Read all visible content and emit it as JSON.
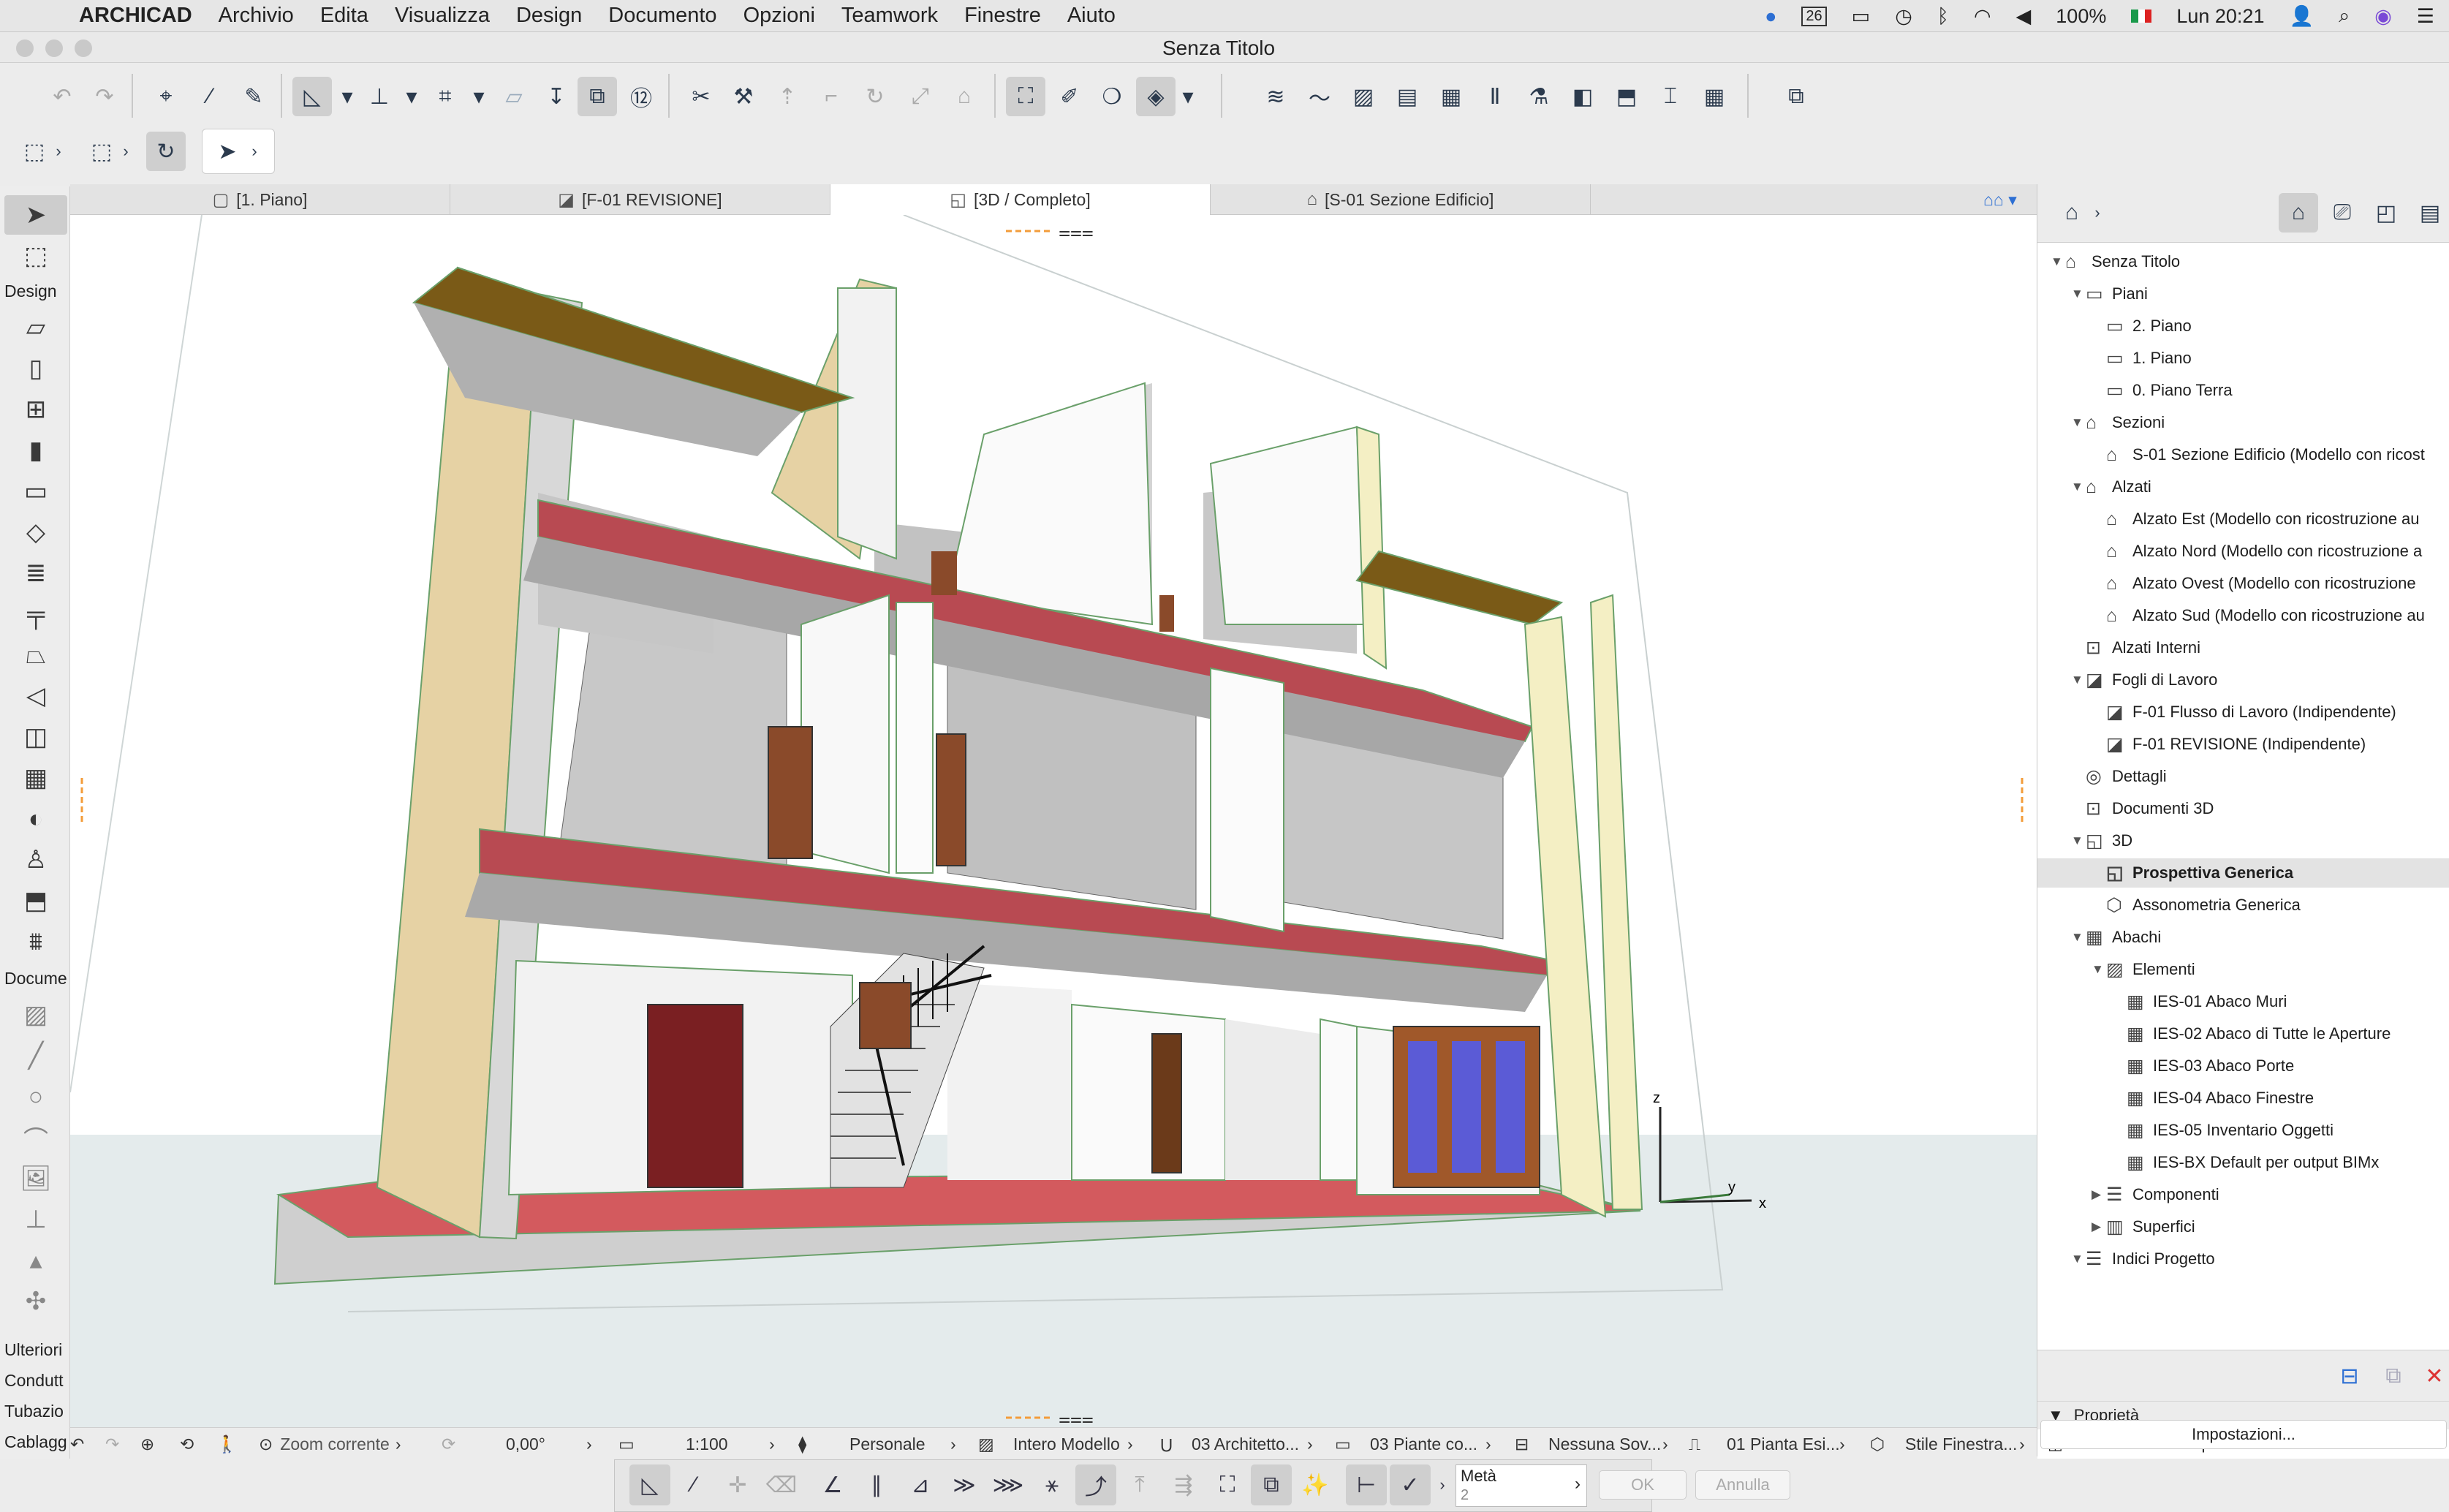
{
  "menubar": {
    "app": "ARCHICAD",
    "items": [
      "Archivio",
      "Edita",
      "Visualizza",
      "Design",
      "Documento",
      "Opzioni",
      "Teamwork",
      "Finestre",
      "Aiuto"
    ],
    "status": {
      "calendar_day": "26",
      "battery": "100%",
      "datetime": "Lun 20:21"
    }
  },
  "window": {
    "title": "Senza Titolo"
  },
  "tabs": [
    {
      "label": "[1. Piano]"
    },
    {
      "label": "[F-01 REVISIONE]"
    },
    {
      "label": "[3D / Completo]"
    },
    {
      "label": "[S-01 Sezione Edificio]"
    }
  ],
  "toolbox": {
    "design_label": "Design",
    "document_label": "Docume",
    "more_label": "Ulteriori",
    "conduit_label": "Condutt",
    "pipe_label": "Tubazio",
    "cable_label": "Cablagg"
  },
  "statusbar": {
    "zoom": "Zoom corrente",
    "angle": "0,00°",
    "scale": "1:100",
    "layer": "Personale",
    "model": "Intero Modello",
    "pen": "03 Architetto...",
    "override": "03 Piante co...",
    "renovation": "Nessuna Sov...",
    "structure": "01 Pianta Esi...",
    "window_style": "Stile Finestra..."
  },
  "infobox": {
    "label": "Metà",
    "value": "2",
    "ok": "OK",
    "cancel": "Annulla"
  },
  "navigator": {
    "tree": [
      {
        "label": "Senza Titolo",
        "level": 0,
        "expand": "open",
        "icon": "project-icon"
      },
      {
        "label": "Piani",
        "level": 1,
        "expand": "open",
        "icon": "stories-icon"
      },
      {
        "label": "2. Piano",
        "level": 2,
        "expand": "",
        "icon": "story-icon"
      },
      {
        "label": "1. Piano",
        "level": 2,
        "expand": "",
        "icon": "story-icon"
      },
      {
        "label": "0. Piano Terra",
        "level": 2,
        "expand": "",
        "icon": "story-icon"
      },
      {
        "label": "Sezioni",
        "level": 1,
        "expand": "open",
        "icon": "section-icon"
      },
      {
        "label": "S-01 Sezione Edificio (Modello con ricost",
        "level": 2,
        "expand": "",
        "icon": "section-icon"
      },
      {
        "label": "Alzati",
        "level": 1,
        "expand": "open",
        "icon": "elevation-icon"
      },
      {
        "label": "Alzato Est (Modello con ricostruzione au",
        "level": 2,
        "expand": "",
        "icon": "elevation-icon"
      },
      {
        "label": "Alzato Nord (Modello con ricostruzione a",
        "level": 2,
        "expand": "",
        "icon": "elevation-icon"
      },
      {
        "label": "Alzato Ovest (Modello con ricostruzione",
        "level": 2,
        "expand": "",
        "icon": "elevation-icon"
      },
      {
        "label": "Alzato Sud (Modello con ricostruzione au",
        "level": 2,
        "expand": "",
        "icon": "elevation-icon"
      },
      {
        "label": "Alzati Interni",
        "level": 1,
        "expand": "",
        "icon": "interior-elevation-icon"
      },
      {
        "label": "Fogli di Lavoro",
        "level": 1,
        "expand": "open",
        "icon": "worksheet-icon"
      },
      {
        "label": "F-01 Flusso di Lavoro (Indipendente)",
        "level": 2,
        "expand": "",
        "icon": "worksheet-icon"
      },
      {
        "label": "F-01 REVISIONE (Indipendente)",
        "level": 2,
        "expand": "",
        "icon": "worksheet-icon"
      },
      {
        "label": "Dettagli",
        "level": 1,
        "expand": "",
        "icon": "detail-icon"
      },
      {
        "label": "Documenti 3D",
        "level": 1,
        "expand": "",
        "icon": "3d-document-icon"
      },
      {
        "label": "3D",
        "level": 1,
        "expand": "open",
        "icon": "3d-icon"
      },
      {
        "label": "Prospettiva Generica",
        "level": 2,
        "expand": "",
        "icon": "perspective-icon",
        "selected": true
      },
      {
        "label": "Assonometria Generica",
        "level": 2,
        "expand": "",
        "icon": "axonometry-icon"
      },
      {
        "label": "Abachi",
        "level": 1,
        "expand": "open",
        "icon": "schedule-icon"
      },
      {
        "label": "Elementi",
        "level": 2,
        "expand": "open",
        "icon": "elements-icon"
      },
      {
        "label": "IES-01 Abaco Muri",
        "level": 3,
        "expand": "",
        "icon": "schedule-icon"
      },
      {
        "label": "IES-02 Abaco di Tutte le Aperture",
        "level": 3,
        "expand": "",
        "icon": "schedule-icon"
      },
      {
        "label": "IES-03 Abaco Porte",
        "level": 3,
        "expand": "",
        "icon": "schedule-icon"
      },
      {
        "label": "IES-04 Abaco Finestre",
        "level": 3,
        "expand": "",
        "icon": "schedule-icon"
      },
      {
        "label": "IES-05 Inventario Oggetti",
        "level": 3,
        "expand": "",
        "icon": "schedule-icon"
      },
      {
        "label": "IES-BX Default per output BIMx",
        "level": 3,
        "expand": "",
        "icon": "schedule-icon"
      },
      {
        "label": "Componenti",
        "level": 2,
        "expand": "closed",
        "icon": "components-icon"
      },
      {
        "label": "Superfici",
        "level": 2,
        "expand": "closed",
        "icon": "surfaces-icon"
      },
      {
        "label": "Indici Progetto",
        "level": 1,
        "expand": "open",
        "icon": "index-icon"
      }
    ],
    "props_title": "Proprietà",
    "props_name": "Prospettiva Generica",
    "props_button": "Impostazioni..."
  },
  "axes": {
    "z": "z",
    "y": "y",
    "x": "x"
  },
  "colors": {
    "accent": "#2d6fd3",
    "slab": "#b84a52",
    "roof": "#7a5a17",
    "wood_wall": "#e6d2a4",
    "floor": "#d35a5e"
  }
}
